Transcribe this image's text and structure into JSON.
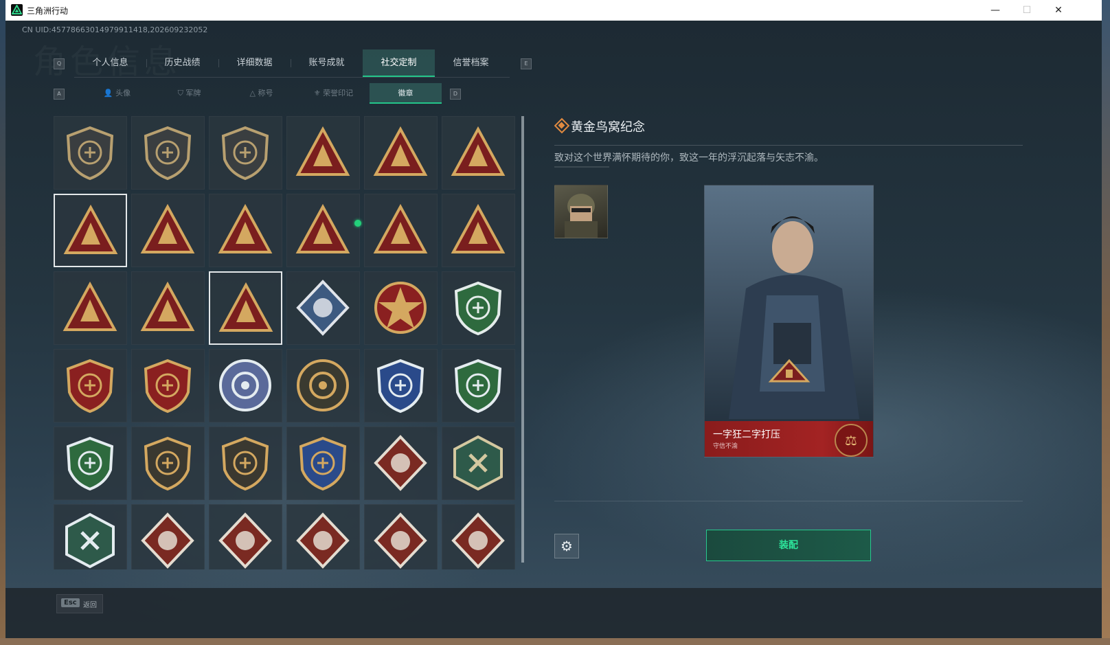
{
  "window": {
    "title": "三角洲行动",
    "controls": [
      "—",
      "☐",
      "✕"
    ]
  },
  "background_ghost_text": "角色信息",
  "uid": "CN UID:45778663014979911418,202609232052",
  "main_tabs": {
    "left_key": "Q",
    "right_key": "E",
    "items": [
      {
        "label": "个人信息"
      },
      {
        "label": "历史战绩"
      },
      {
        "label": "详细数据"
      },
      {
        "label": "账号成就"
      },
      {
        "label": "社交定制",
        "active": true
      },
      {
        "label": "信誉档案"
      }
    ]
  },
  "sub_tabs": {
    "left_key": "A",
    "right_key": "D",
    "items": [
      {
        "label": "头像",
        "icon": "person-icon"
      },
      {
        "label": "军牌",
        "icon": "dogtag-icon"
      },
      {
        "label": "称号",
        "icon": "title-icon"
      },
      {
        "label": "荣誉印记",
        "icon": "honor-icon"
      },
      {
        "label": "徽章",
        "active": true
      }
    ]
  },
  "badges": [
    {
      "shape": "shield",
      "color": "#3a3e40",
      "accent": "#b8a070",
      "sel": false
    },
    {
      "shape": "shield",
      "color": "#3a3e40",
      "accent": "#b8a070",
      "sel": false
    },
    {
      "shape": "shield",
      "color": "#3a3e40",
      "accent": "#b8a070",
      "sel": false
    },
    {
      "shape": "triangle",
      "color": "#7a1e1e",
      "accent": "#d4a860",
      "sel": false
    },
    {
      "shape": "triangle",
      "color": "#7a1e1e",
      "accent": "#d4a860",
      "sel": false
    },
    {
      "shape": "triangle",
      "color": "#7a1e1e",
      "accent": "#d4a860",
      "sel": false
    },
    {
      "shape": "triangle",
      "color": "#7a1e1e",
      "accent": "#d4a860",
      "sel": true
    },
    {
      "shape": "triangle",
      "color": "#7a1e1e",
      "accent": "#d4a860",
      "sel": false
    },
    {
      "shape": "triangle",
      "color": "#7a1e1e",
      "accent": "#d4a860",
      "sel": false
    },
    {
      "shape": "triangle",
      "color": "#7a1e1e",
      "accent": "#d4a860",
      "sel": false
    },
    {
      "shape": "triangle",
      "color": "#7a1e1e",
      "accent": "#d4a860",
      "sel": false
    },
    {
      "shape": "triangle",
      "color": "#7a1e1e",
      "accent": "#d4a860",
      "sel": false
    },
    {
      "shape": "triangle",
      "color": "#7a1e1e",
      "accent": "#d4a860",
      "sel": false
    },
    {
      "shape": "triangle",
      "color": "#7a1e1e",
      "accent": "#d4a860",
      "sel": false
    },
    {
      "shape": "triangle",
      "color": "#7a1e1e",
      "accent": "#d4a860",
      "sel": true
    },
    {
      "shape": "diamond",
      "color": "#3d5a80",
      "accent": "#e0e4ea",
      "sel": false
    },
    {
      "shape": "star",
      "color": "#8a2020",
      "accent": "#d4a860",
      "sel": false
    },
    {
      "shape": "shield",
      "color": "#2e6a3e",
      "accent": "#e4ecea",
      "sel": false
    },
    {
      "shape": "shield",
      "color": "#8a2020",
      "accent": "#d4a860",
      "sel": false
    },
    {
      "shape": "shield",
      "color": "#8a2020",
      "accent": "#d4a860",
      "sel": false
    },
    {
      "shape": "circle",
      "color": "#5a6a9a",
      "accent": "#e4ecf0",
      "sel": false
    },
    {
      "shape": "circle",
      "color": "#3a3a30",
      "accent": "#d4a860",
      "sel": false
    },
    {
      "shape": "shield",
      "color": "#2a4a8a",
      "accent": "#e4ecf0",
      "sel": false
    },
    {
      "shape": "shield",
      "color": "#2e6a3e",
      "accent": "#e4ecf0",
      "sel": false
    },
    {
      "shape": "shield",
      "color": "#2e6a3e",
      "accent": "#e4ecf0",
      "sel": false
    },
    {
      "shape": "shield",
      "color": "#3a3830",
      "accent": "#d4a860",
      "sel": false
    },
    {
      "shape": "shield",
      "color": "#3a3830",
      "accent": "#d4a860",
      "sel": false
    },
    {
      "shape": "shield",
      "color": "#2a4a8a",
      "accent": "#d4a860",
      "sel": false
    },
    {
      "shape": "diamond",
      "color": "#7a2a22",
      "accent": "#e4dcd0",
      "sel": false
    },
    {
      "shape": "hex",
      "color": "#2e5a4a",
      "accent": "#d4c8a0",
      "sel": false
    },
    {
      "shape": "hex",
      "color": "#2e5a4a",
      "accent": "#e4ecf0",
      "sel": false
    },
    {
      "shape": "diamond",
      "color": "#7a2a22",
      "accent": "#e4dcd0",
      "sel": false
    },
    {
      "shape": "diamond",
      "color": "#7a2a22",
      "accent": "#e4dcd0",
      "sel": false
    },
    {
      "shape": "diamond",
      "color": "#7a2a22",
      "accent": "#e4dcd0",
      "sel": false
    },
    {
      "shape": "diamond",
      "color": "#7a2a22",
      "accent": "#e4dcd0",
      "sel": false
    },
    {
      "shape": "diamond",
      "color": "#7a2a22",
      "accent": "#e4dcd0",
      "sel": false
    }
  ],
  "detail": {
    "name": "黄金鸟窝纪念",
    "description": "致对这个世界满怀期待的你，致这一年的浮沉起落与矢志不渝。",
    "card": {
      "title": "一字狂二字打压",
      "subtitle": "守信不渝",
      "medal_icon": "⚖"
    },
    "equip_label": "装配",
    "settings_icon": "⚙"
  },
  "bottom": {
    "esc_key": "Esc",
    "esc_label": "返回"
  },
  "colors": {
    "accent_green": "#23c68a",
    "title_orange": "#e08a40"
  }
}
